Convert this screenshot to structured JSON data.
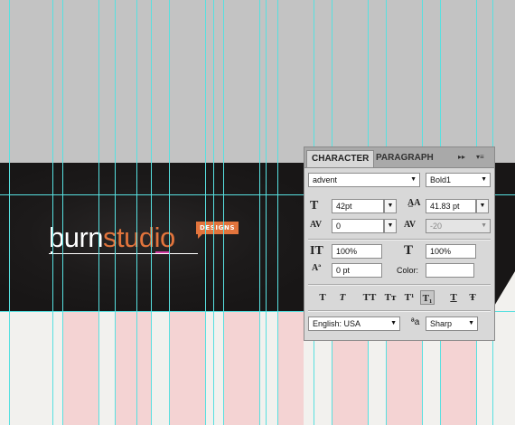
{
  "canvas": {
    "logo_part1": "burn",
    "logo_part2": "studio",
    "tag": "DESIGNS"
  },
  "panel": {
    "tabs": [
      "CHARACTER",
      "PARAGRAPH"
    ],
    "menu_icons": [
      "▸▸",
      "▾≡"
    ],
    "font_family": "advent",
    "font_style": "Bold1",
    "font_size": "42pt",
    "leading": "41.83 pt",
    "kerning": "0",
    "tracking": "-20",
    "vertical_scale": "100%",
    "horizontal_scale": "100%",
    "baseline_shift": "0 pt",
    "color_label": "Color:",
    "color_value": "#ffffff",
    "style_buttons": [
      "T",
      "T",
      "TT",
      "Tт",
      "T¹",
      "T₁",
      "T",
      "Ŧ"
    ],
    "language": "English: USA",
    "antialias_icon": "ªa",
    "antialias": "Sharp"
  }
}
